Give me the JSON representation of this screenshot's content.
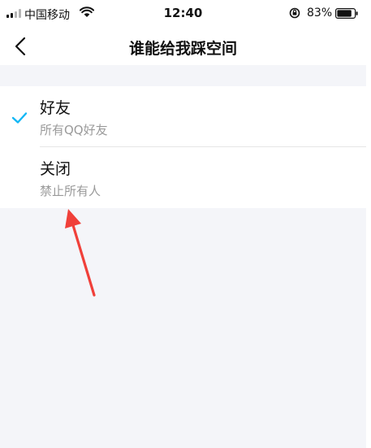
{
  "status_bar": {
    "carrier": "中国移动",
    "time": "12:40",
    "battery_percent": "83%",
    "icons": [
      "signal-icon",
      "wifi-icon",
      "rotation-lock-icon",
      "battery-icon"
    ]
  },
  "nav": {
    "title": "谁能给我踩空间",
    "back_icon": "chevron-left-icon"
  },
  "options": [
    {
      "label": "好友",
      "description": "所有QQ好友",
      "selected": true
    },
    {
      "label": "关闭",
      "description": "禁止所有人",
      "selected": false
    }
  ],
  "colors": {
    "accent": "#12b7f5",
    "background": "#f4f5f9",
    "annotation": "#f0403a"
  }
}
